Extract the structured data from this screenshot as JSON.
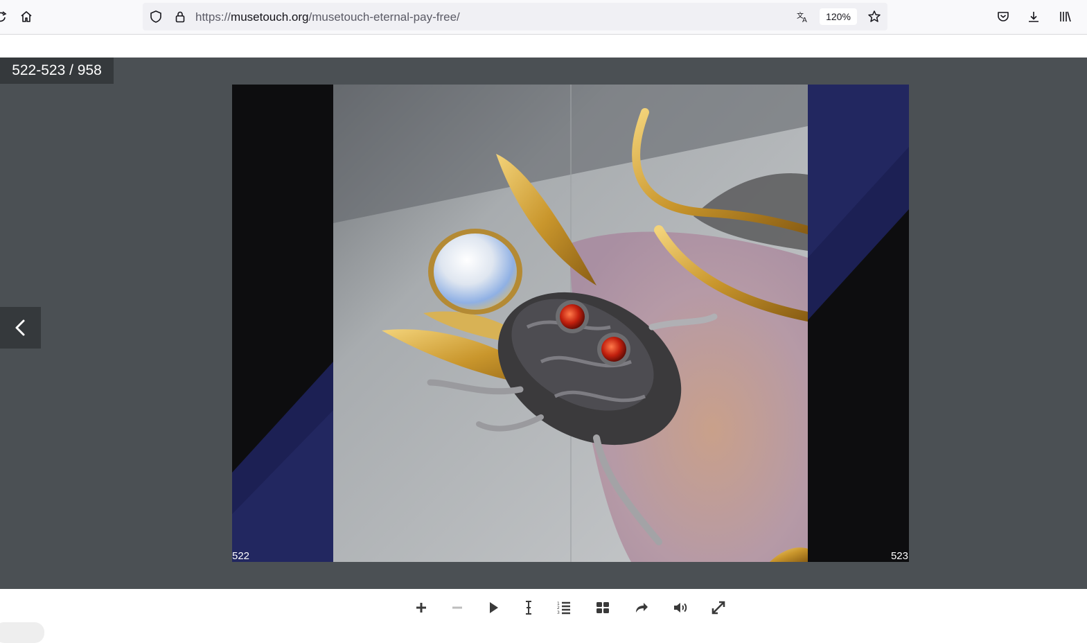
{
  "browser": {
    "url_prefix": "https://",
    "url_domain": "musetouch.org",
    "url_path": "/musetouch-eternal-pay-free/",
    "zoom": "120%",
    "icons": [
      "home-icon",
      "shield-icon",
      "lock-icon",
      "translate-icon",
      "star-icon",
      "pocket-icon",
      "download-icon",
      "library-icon"
    ]
  },
  "viewer": {
    "page_counter": "522-523 / 958",
    "left_page_number": "522",
    "right_page_number": "523"
  },
  "controls": {
    "icons": [
      "zoom-in-icon",
      "zoom-out-icon",
      "play-icon",
      "text-select-icon",
      "table-of-contents-icon",
      "thumbnails-icon",
      "share-icon",
      "sound-icon",
      "fullscreen-icon"
    ]
  },
  "colors": {
    "viewer_bg": "#4b5054",
    "counter_bg": "#35393c",
    "page_edge_blue": "#1c2054"
  }
}
